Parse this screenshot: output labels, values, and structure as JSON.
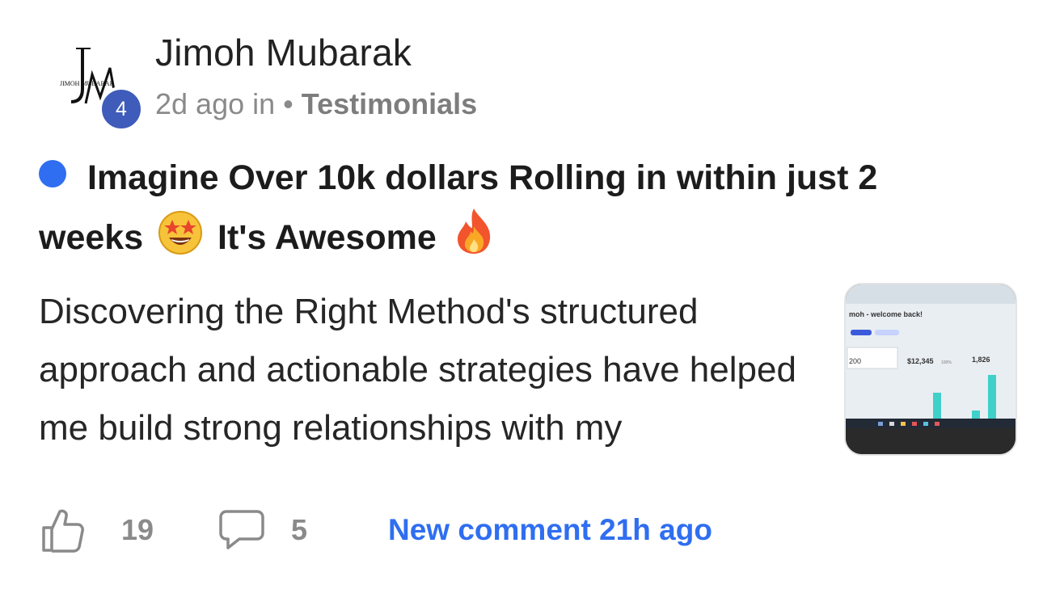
{
  "author": {
    "name": "Jimoh Mubarak",
    "level": "4",
    "logo_text": "JIMOH MUBARAK"
  },
  "meta": {
    "time": "2d ago in",
    "separator": "•",
    "category": "Testimonials"
  },
  "post": {
    "title_part1": "Imagine Over 10k dollars Rolling in within just 2 weeks",
    "title_emoji1": "star-struck-emoji",
    "title_part2": "It's Awesome",
    "title_emoji2": "fire-emoji",
    "body": "Discovering the Right Method's structured approach and actionable strategies have helped me build strong relationships with my",
    "thumbnail": {
      "welcome_text": "moh - welcome back!",
      "stat1": "200",
      "stat2": "$12,345",
      "stat3": "1,826",
      "pct": "100%"
    }
  },
  "footer": {
    "likes": "19",
    "comments": "5",
    "new_comment_text": "New comment 21h ago"
  },
  "colors": {
    "accent": "#2f6ef0",
    "badge": "#3f5cba",
    "muted": "#8a8a8a"
  }
}
